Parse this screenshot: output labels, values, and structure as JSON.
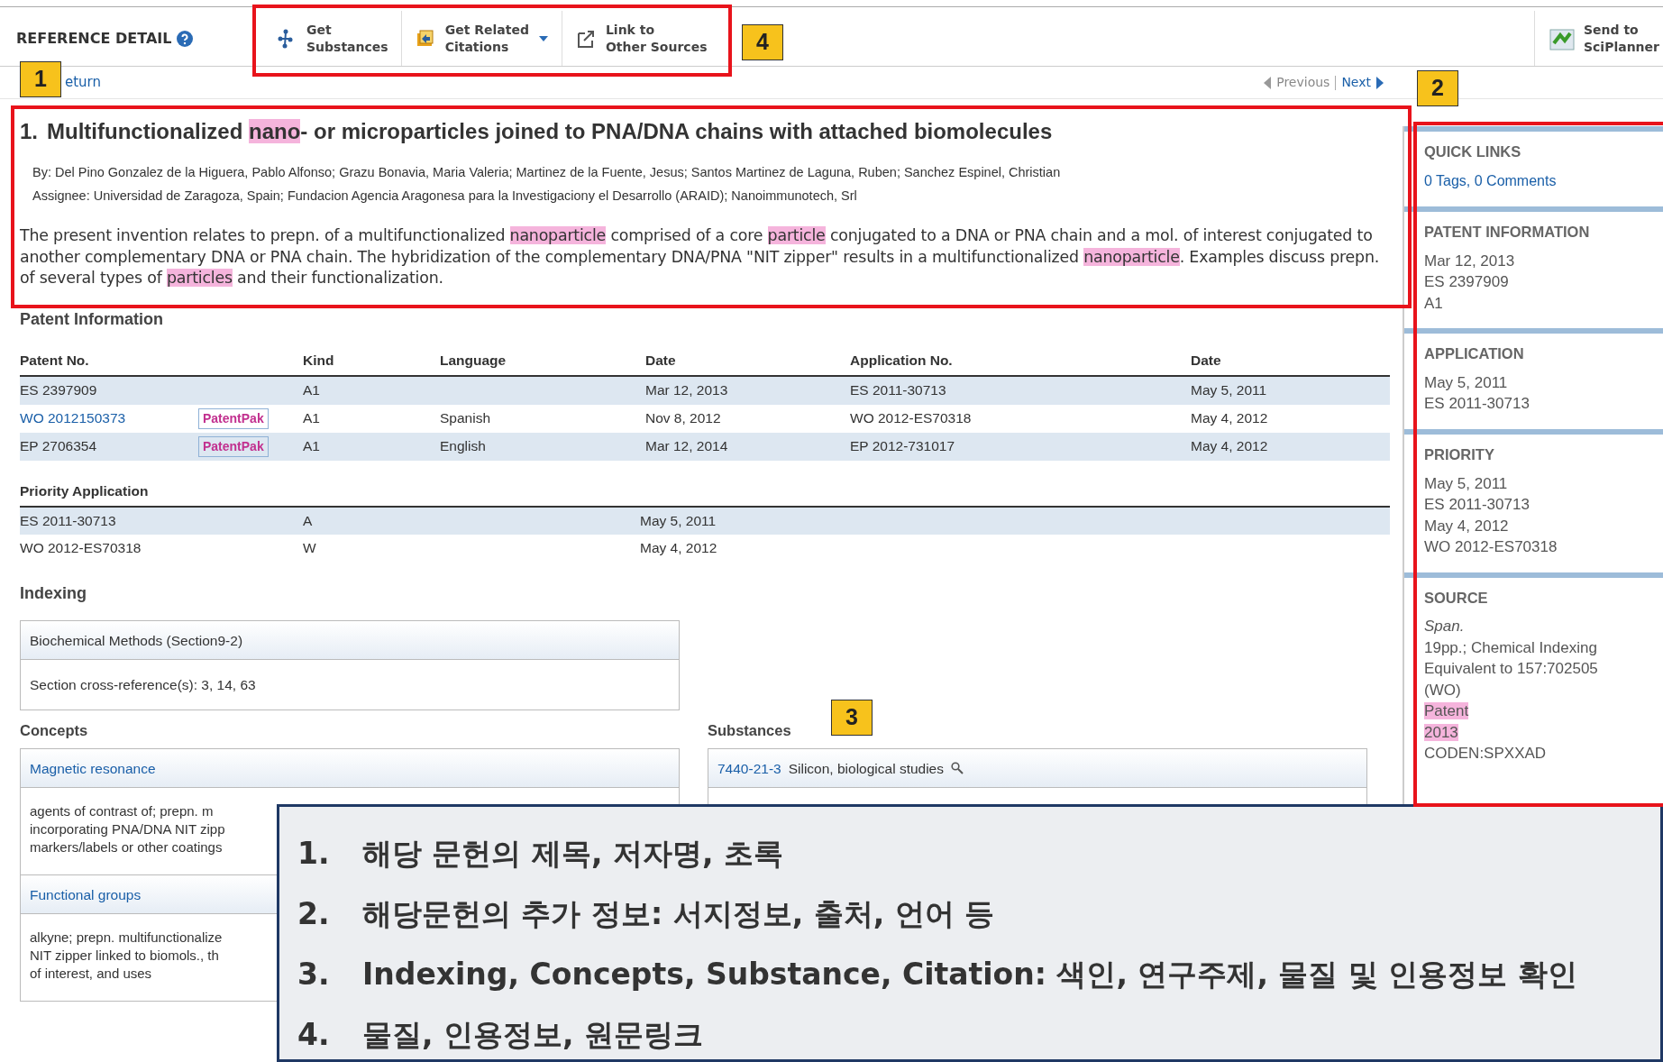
{
  "header": {
    "title": "REFERENCE DETAIL",
    "buttons": [
      {
        "lines": [
          "Get",
          "Substances"
        ],
        "dropdown": false
      },
      {
        "lines": [
          "Get Related",
          "Citations"
        ],
        "dropdown": true
      },
      {
        "lines": [
          "Link to",
          "Other Sources"
        ],
        "dropdown": false
      }
    ],
    "send": {
      "lines": [
        "Send to",
        "SciPlanner"
      ]
    }
  },
  "nav": {
    "return": "eturn",
    "previous": "Previous",
    "next": "Next"
  },
  "reference": {
    "number": "1.",
    "title": [
      {
        "text": "Multifunctionalized ",
        "highlighted": false
      },
      {
        "text": "nano",
        "highlighted": true
      },
      {
        "text": "- or microparticles joined to PNA/DNA chains with attached biomolecules",
        "highlighted": false
      }
    ],
    "authors": "By: Del Pino Gonzalez de la Higuera, Pablo Alfonso; Grazu Bonavia, Maria Valeria; Martinez de la Fuente, Jesus; Santos Martinez de Laguna, Ruben; Sanchez Espinel, Christian",
    "assignee": "Assignee: Universidad de Zaragoza, Spain; Fundacion Agencia Aragonesa para la Investigaciony el Desarrollo (ARAID); Nanoimmunotech, Srl",
    "abstract": [
      {
        "text": "The present invention relates to prepn. of a multifunctionalized ",
        "highlighted": false
      },
      {
        "text": "nanoparticle",
        "highlighted": true
      },
      {
        "text": " comprised of a core ",
        "highlighted": false
      },
      {
        "text": "particle",
        "highlighted": true
      },
      {
        "text": " conjugated to a DNA or PNA chain and a mol. of interest conjugated to another complementary DNA or PNA chain.  The hybridization of the complementary DNA/PNA \"NIT zipper\" results in a multifunctionalized ",
        "highlighted": false
      },
      {
        "text": "nanoparticle",
        "highlighted": true
      },
      {
        "text": ".  Examples discuss prepn. of several types of ",
        "highlighted": false
      },
      {
        "text": "particles",
        "highlighted": true
      },
      {
        "text": " and their functionalization.",
        "highlighted": false
      }
    ]
  },
  "patent_information": {
    "heading": "Patent Information",
    "columns": [
      "Patent No.",
      "Kind",
      "Language",
      "Date",
      "Application No.",
      "Date"
    ],
    "rows": [
      {
        "patent_no": "ES 2397909",
        "link": false,
        "kind": "A1",
        "date": "Mar 12, 2013",
        "application_no": "ES 2011-30713",
        "application_date": "May 5, 2011"
      },
      {
        "patent_no": "WO 2012150373",
        "link": true,
        "patentpak": "PatentPak",
        "kind": "A1",
        "language": "Spanish",
        "date": "Nov 8, 2012",
        "application_no": "WO 2012-ES70318",
        "application_date": "May 4, 2012"
      },
      {
        "patent_no": "EP 2706354",
        "link": false,
        "patentpak": "PatentPak",
        "kind": "A1",
        "language": "English",
        "date": "Mar 12, 2014",
        "application_no": "EP 2012-731017",
        "application_date": "May 4, 2012"
      }
    ]
  },
  "priority_application": {
    "heading": "Priority Application",
    "rows": [
      {
        "number": "ES 2011-30713",
        "kind": "A",
        "date": "May 5, 2011"
      },
      {
        "number": "WO 2012-ES70318",
        "kind": "W",
        "date": "May 4, 2012"
      }
    ]
  },
  "indexing": {
    "heading": "Indexing",
    "section": "Biochemical Methods (Section9-2)",
    "cross_reference": "Section cross-reference(s): 3, 14, 63"
  },
  "concepts": {
    "heading": "Concepts",
    "items": [
      {
        "term": "Magnetic resonance",
        "lines": [
          "agents of contrast of; prepn. m",
          "incorporating PNA/DNA NIT zipp",
          "markers/labels or other coatings"
        ]
      },
      {
        "term": "Functional groups",
        "lines": [
          "alkyne; prepn. multifunctionalize",
          "NIT zipper linked to biomols., th",
          "of interest, and uses"
        ]
      }
    ]
  },
  "substances": {
    "heading": "Substances",
    "items": [
      {
        "rn": "7440-21-3",
        "name": "Silicon, biological studies"
      }
    ]
  },
  "sidebar": [
    {
      "heading": "QUICK LINKS",
      "lines": [
        {
          "text": "0 Tags, 0 Comments",
          "kind": "link"
        }
      ]
    },
    {
      "heading": "PATENT INFORMATION",
      "lines": [
        {
          "text": "Mar 12, 2013",
          "kind": "plain"
        },
        {
          "text": "ES 2397909",
          "kind": "plain"
        },
        {
          "text": "A1",
          "kind": "plain"
        }
      ]
    },
    {
      "heading": "APPLICATION",
      "lines": [
        {
          "text": "May 5, 2011",
          "kind": "plain"
        },
        {
          "text": "ES 2011-30713",
          "kind": "plain"
        }
      ]
    },
    {
      "heading": "PRIORITY",
      "lines": [
        {
          "text": "May 5, 2011",
          "kind": "plain"
        },
        {
          "text": "ES 2011-30713",
          "kind": "plain"
        },
        {
          "text": "May 4, 2012",
          "kind": "plain"
        },
        {
          "text": "WO 2012-ES70318",
          "kind": "plain"
        }
      ]
    },
    {
      "heading": "SOURCE",
      "lines": [
        {
          "text": "Span.",
          "kind": "italic"
        },
        {
          "text": "19pp.; Chemical Indexing",
          "kind": "plain"
        },
        {
          "text": "Equivalent to 157:702505",
          "kind": "plain"
        },
        {
          "text": "(WO)",
          "kind": "plain"
        },
        {
          "text": "Patent",
          "kind": "highlighted"
        },
        {
          "text": "2013",
          "kind": "highlighted"
        },
        {
          "text": "CODEN:SPXXAD",
          "kind": "plain"
        }
      ]
    }
  ],
  "callouts": [
    "1",
    "2",
    "3",
    "4"
  ],
  "notes": [
    {
      "number": "1.",
      "text": "해당 문헌의 제목, 저자명, 초록"
    },
    {
      "number": "2.",
      "text": "해당문헌의 추가 정보: 서지정보, 출처, 언어 등"
    },
    {
      "number": "3.",
      "text": "Indexing, Concepts, Substance, Citation: 색인, 연구주제, 물질 및 인용정보 확인"
    },
    {
      "number": "4.",
      "text": "물질, 인용정보, 원문링크"
    }
  ]
}
